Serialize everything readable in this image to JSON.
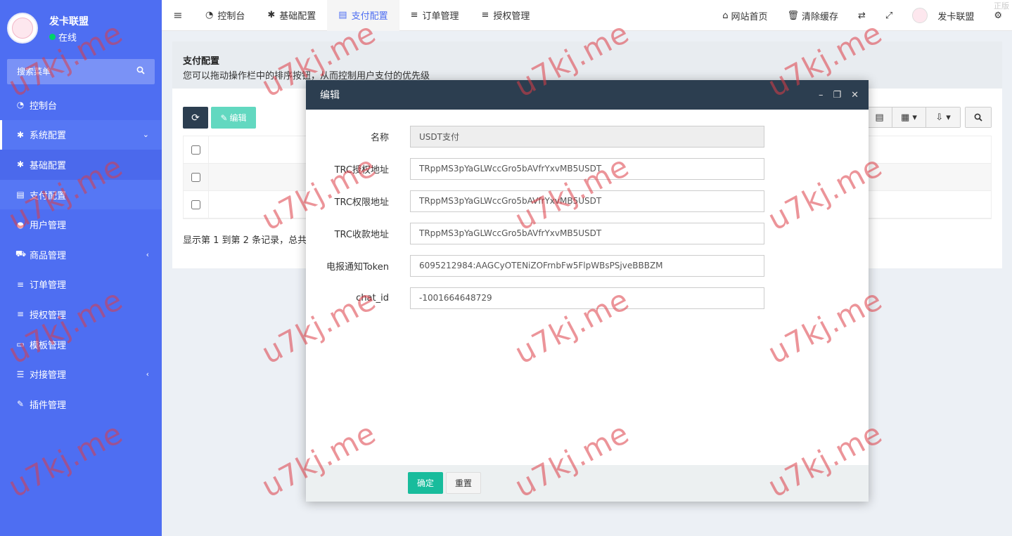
{
  "sidebar": {
    "brand_name": "发卡联盟",
    "status": "在线",
    "search_placeholder": "搜索菜单",
    "items": [
      {
        "label": "控制台",
        "icon": "dashboard-icon"
      },
      {
        "label": "系统配置",
        "icon": "gear-icon"
      },
      {
        "label": "基础配置",
        "icon": "gear-icon"
      },
      {
        "label": "支付配置",
        "icon": "list-alt-icon"
      },
      {
        "label": "用户管理",
        "icon": "user-icon"
      },
      {
        "label": "商品管理",
        "icon": "cart-icon"
      },
      {
        "label": "订单管理",
        "icon": "list-icon"
      },
      {
        "label": "授权管理",
        "icon": "list-icon"
      },
      {
        "label": "模板管理",
        "icon": "card-icon"
      },
      {
        "label": "对接管理",
        "icon": "sliders-icon"
      },
      {
        "label": "插件管理",
        "icon": "plug-icon"
      }
    ]
  },
  "topbar": {
    "tabs": [
      {
        "label": "控制台"
      },
      {
        "label": "基础配置"
      },
      {
        "label": "支付配置"
      },
      {
        "label": "订单管理"
      },
      {
        "label": "授权管理"
      }
    ],
    "home_label": "网站首页",
    "clear_cache_label": "清除缓存",
    "user_label": "发卡联盟",
    "corner": "正版"
  },
  "panel": {
    "title": "支付配置",
    "desc": "您可以拖动操作栏中的排序按钮，从而控制用户支付的优先级",
    "edit_label": "编辑",
    "pager": "显示第 1 到第 2 条记录，总共"
  },
  "modal": {
    "title": "编辑",
    "fields": [
      {
        "label": "名称",
        "value": "USDT支付"
      },
      {
        "label": "TRC授权地址",
        "value": "TRppMS3pYaGLWccGro5bAVfrYxvMB5USDT"
      },
      {
        "label": "TRC权限地址",
        "value": "TRppMS3pYaGLWccGro5bAVfrYxvMB5USDT"
      },
      {
        "label": "TRC收款地址",
        "value": "TRppMS3pYaGLWccGro5bAVfrYxvMB5USDT"
      },
      {
        "label": "电报通知Token",
        "value": "6095212984:AAGCyOTENiZOFrnbFw5FlpWBsPSjveBBBZM"
      },
      {
        "label": "chat_id",
        "value": "-1001664648729"
      }
    ],
    "ok_label": "确定",
    "reset_label": "重置"
  },
  "watermark": "u7kj.me"
}
